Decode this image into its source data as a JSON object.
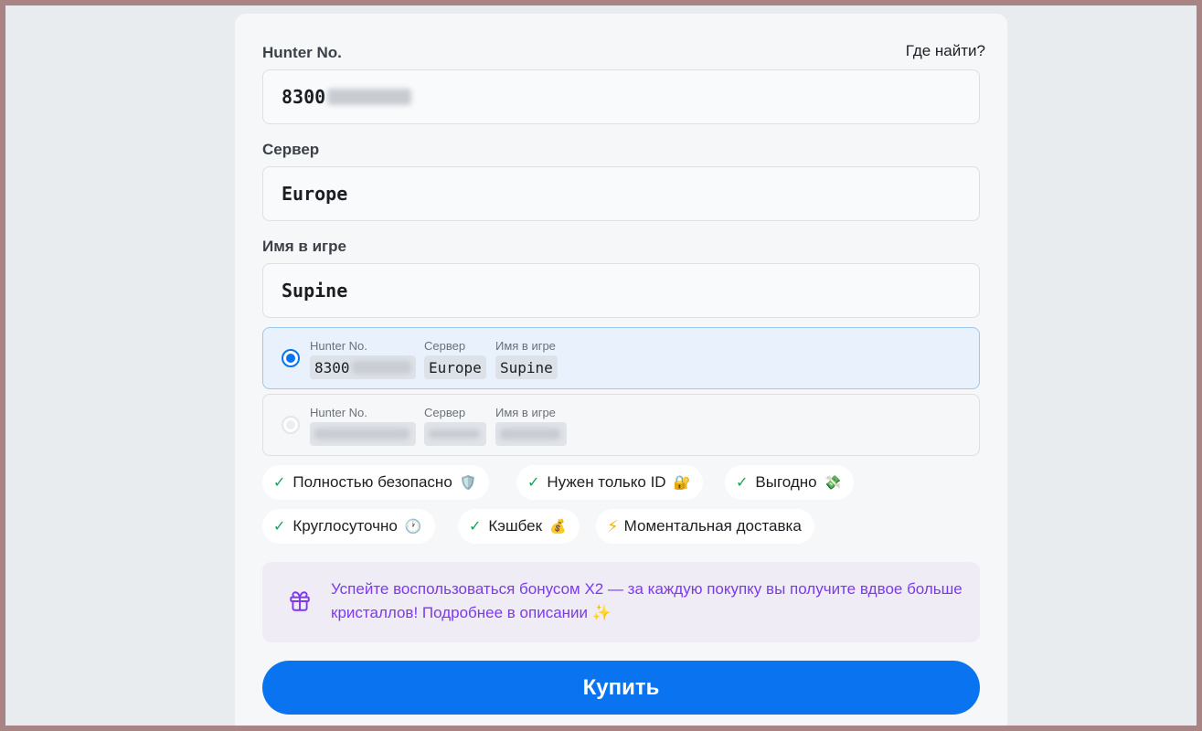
{
  "form": {
    "hunter_label": "Hunter No.",
    "where_link": "Где найти?",
    "hunter_value": "8300",
    "server_label": "Сервер",
    "server_value": "Europe",
    "name_label": "Имя в игре",
    "name_value": "Supine"
  },
  "accounts": [
    {
      "selected": true,
      "hunter_label": "Hunter No.",
      "hunter_value": "8300",
      "server_label": "Сервер",
      "server_value": "Europe",
      "name_label": "Имя в игре",
      "name_value": "Supine"
    },
    {
      "selected": false,
      "hunter_label": "Hunter No.",
      "server_label": "Сервер",
      "name_label": "Имя в игре"
    }
  ],
  "features": [
    {
      "label": "Полностью безопасно",
      "icon": "shield-emoji"
    },
    {
      "label": "Нужен только ID",
      "icon": "lock-emoji"
    },
    {
      "label": "Выгодно",
      "icon": "money-emoji"
    },
    {
      "label": "Круглосуточно",
      "icon": "clock-emoji"
    },
    {
      "label": "Кэшбек",
      "icon": "money-bag-emoji"
    },
    {
      "label": "Моментальная доставка",
      "icon": "lightning-icon"
    }
  ],
  "bonus": {
    "text": "Успейте воспользоваться бонусом X2 — за каждую покупку вы получите вдвое больше кристаллов! Подробнее в описании ✨",
    "icon": "gift-icon"
  },
  "buy_button": "Купить",
  "colors": {
    "accent": "#0a74f0",
    "bonus_text": "#7c3aed",
    "check": "#1f9d55"
  }
}
